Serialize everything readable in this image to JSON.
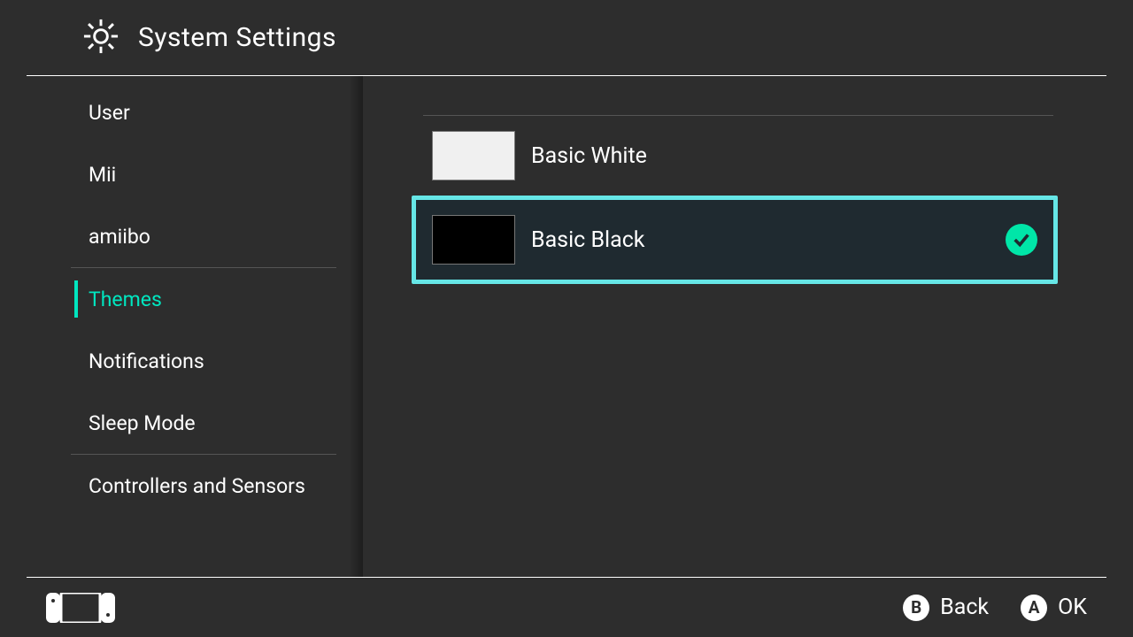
{
  "header": {
    "title": "System Settings"
  },
  "sidebar": {
    "items": [
      {
        "label": "User"
      },
      {
        "label": "Mii"
      },
      {
        "label": "amiibo"
      },
      {
        "label": "Themes",
        "active": true
      },
      {
        "label": "Notifications"
      },
      {
        "label": "Sleep Mode"
      },
      {
        "label": "Controllers and Sensors"
      }
    ]
  },
  "themes": {
    "options": [
      {
        "label": "Basic White",
        "selected": false,
        "highlighted": false
      },
      {
        "label": "Basic Black",
        "selected": true,
        "highlighted": true
      }
    ]
  },
  "footer": {
    "buttons": [
      {
        "glyph": "B",
        "label": "Back"
      },
      {
        "glyph": "A",
        "label": "OK"
      }
    ]
  }
}
